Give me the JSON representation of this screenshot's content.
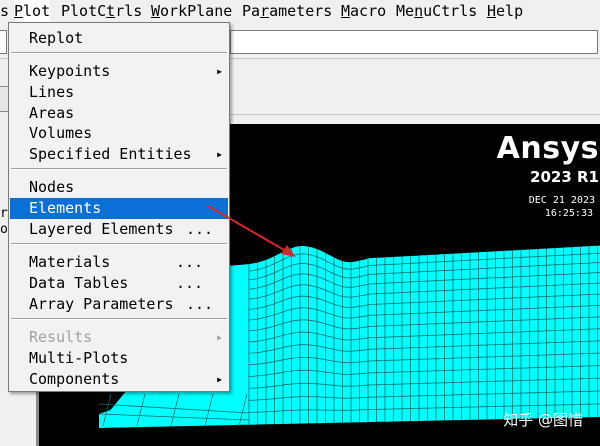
{
  "menubar": {
    "items": [
      {
        "label": "Plot",
        "mnemonic_index": 0
      },
      {
        "label": "PlotCtrls",
        "mnemonic_index": 5
      },
      {
        "label": "WorkPlane",
        "mnemonic_index": 0
      },
      {
        "label": "Parameters",
        "mnemonic_index": 2
      },
      {
        "label": "Macro",
        "mnemonic_index": 0
      },
      {
        "label": "MenuCtrls",
        "mnemonic_index": 2
      },
      {
        "label": "Help",
        "mnemonic_index": 0
      }
    ],
    "left_fragment": "s"
  },
  "dropdown": {
    "items": [
      {
        "label": "Replot",
        "submenu": false,
        "dots": "",
        "state": "normal"
      },
      {
        "label": "Keypoints",
        "submenu": true,
        "dots": "",
        "state": "normal"
      },
      {
        "label": "Lines",
        "submenu": false,
        "dots": "",
        "state": "normal"
      },
      {
        "label": "Areas",
        "submenu": false,
        "dots": "",
        "state": "normal"
      },
      {
        "label": "Volumes",
        "submenu": false,
        "dots": "",
        "state": "normal"
      },
      {
        "label": "Specified Entities",
        "submenu": true,
        "dots": "",
        "state": "normal"
      },
      {
        "label": "Nodes",
        "submenu": false,
        "dots": "",
        "state": "normal"
      },
      {
        "label": "Elements",
        "submenu": false,
        "dots": "",
        "state": "selected"
      },
      {
        "label": "Layered Elements",
        "submenu": false,
        "dots": "...",
        "state": "normal"
      },
      {
        "label": "Materials",
        "submenu": false,
        "dots": "...",
        "state": "normal"
      },
      {
        "label": "Data Tables",
        "submenu": false,
        "dots": "...",
        "state": "normal"
      },
      {
        "label": "Array Parameters",
        "submenu": false,
        "dots": "...",
        "state": "normal"
      },
      {
        "label": "Results",
        "submenu": true,
        "dots": "",
        "state": "disabled"
      },
      {
        "label": "Multi-Plots",
        "submenu": false,
        "dots": "",
        "state": "normal"
      },
      {
        "label": "Components",
        "submenu": true,
        "dots": "",
        "state": "normal"
      }
    ]
  },
  "graphics": {
    "brand": "Ansys",
    "version": "2023 R1",
    "date": "DEC 21 2023",
    "time": "16:25:33"
  },
  "left_text": {
    "line1": "rc",
    "line2": "or"
  },
  "watermark": "知乎 @图惜",
  "colors": {
    "menu_selection": "#0a6fd6",
    "mesh_fill": "#00ffff",
    "mesh_lines": "#0b6c6c",
    "annotation_arrow": "#d9262b",
    "graphics_background": "#000000"
  },
  "icons": {
    "submenu": "triangle-right-icon"
  }
}
